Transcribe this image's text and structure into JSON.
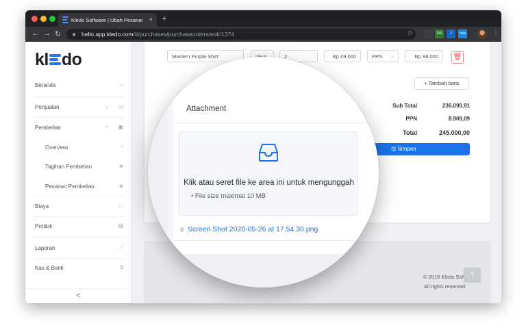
{
  "browser": {
    "tab_title": "Kledo Software | Ubah Pesanan",
    "tab_close": "×",
    "new_tab": "+",
    "url_host": "hello.app.kledo.com",
    "url_path": "/#/purchases/purchaseorders/edit/1374",
    "ext_badges": [
      "160",
      "2",
      "new"
    ]
  },
  "sidebar": {
    "logo": {
      "left": "kl",
      "right": "do"
    },
    "items": [
      {
        "label": "Beranda"
      },
      {
        "label": "Penjualan"
      },
      {
        "label": "Pembelian"
      },
      {
        "label": "Overview"
      },
      {
        "label": "Tagihan Pembelian"
      },
      {
        "label": "Pesanan Pembelian"
      },
      {
        "label": "Biaya"
      },
      {
        "label": "Produk"
      },
      {
        "label": "Laporan"
      },
      {
        "label": "Kas & Bank"
      }
    ],
    "kas_icon": "$",
    "collapse_label": "<"
  },
  "line_item": {
    "product": "Moslem Purple Shirt",
    "unit": "Ukur",
    "qty": "2",
    "price": "Rp 49.000",
    "tax": "PPN",
    "amount": "Rp 98.000"
  },
  "actions": {
    "add_row": "+ Tambah baris",
    "save": "Simpan"
  },
  "summary": {
    "subtotal_label": "Sub Total",
    "subtotal_value": "236.090,91",
    "tax_label": "PPN",
    "tax_value": "8.909,09",
    "total_label": "Total",
    "total_value": "245.000,00"
  },
  "attachment": {
    "title": "Attachment",
    "drop_text": "Klik atau seret file ke area ini untuk mengunggah",
    "hint": "File size maximal 10 MB",
    "file_name": "Screen Shot 2020-05-26 at 17.54.30.png"
  },
  "footer": {
    "copyright": "© 2019 Kledo Soft",
    "rights": "All rights reserved"
  },
  "colors": {
    "brand_blue": "#1a73e8",
    "danger": "#e55353"
  }
}
